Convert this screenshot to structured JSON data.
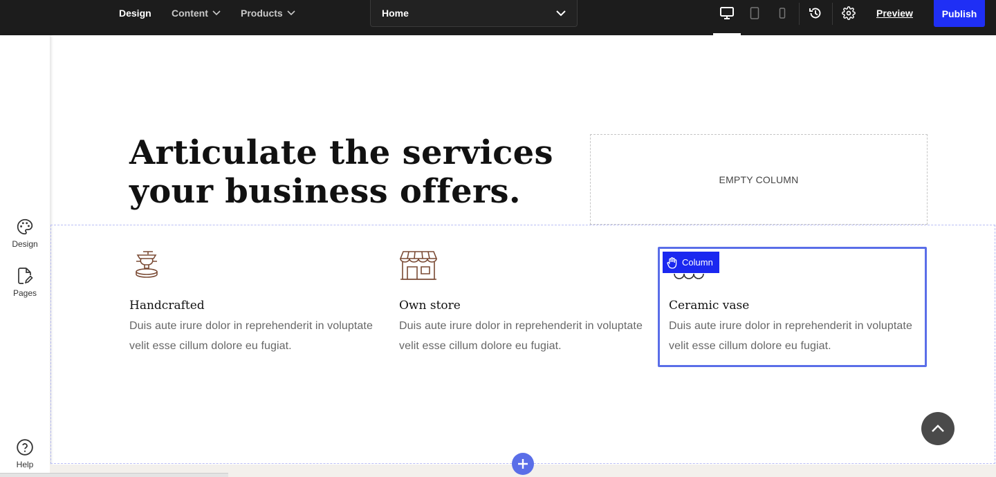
{
  "topbar": {
    "nav": [
      {
        "label": "Design",
        "dropdown": false
      },
      {
        "label": "Content",
        "dropdown": true
      },
      {
        "label": "Products",
        "dropdown": true
      }
    ],
    "page_select": "Home",
    "devices": [
      "desktop-icon",
      "tablet-icon",
      "mobile-icon"
    ],
    "active_device": "desktop",
    "preview_label": "Preview",
    "publish_label": "Publish",
    "publish_color": "#1f2ff5"
  },
  "sidebar": {
    "items": [
      {
        "label": "Design",
        "icon": "palette-icon"
      },
      {
        "label": "Pages",
        "icon": "page-edit-icon"
      }
    ],
    "help_label": "Help"
  },
  "main": {
    "headline": "Articulate the services your business offers.",
    "empty_column_label": "EMPTY COLUMN",
    "column_badge_label": "Column",
    "features": [
      {
        "title": "Handcrafted",
        "text": "Duis aute irure dolor in reprehenderit in voluptate velit esse cillum dolore eu fugiat.",
        "icon": "pottery-wheel-icon"
      },
      {
        "title": "Own store",
        "text": "Duis aute irure dolor in reprehenderit in voluptate velit esse cillum dolore eu fugiat.",
        "icon": "storefront-icon"
      },
      {
        "title": "Ceramic vase",
        "text": "Duis aute irure dolor in reprehenderit in voluptate velit esse cillum dolore eu fugiat.",
        "icon": "vase-icon"
      }
    ],
    "accent_color": "#5a6ee8",
    "icon_color": "#7a4a34"
  }
}
